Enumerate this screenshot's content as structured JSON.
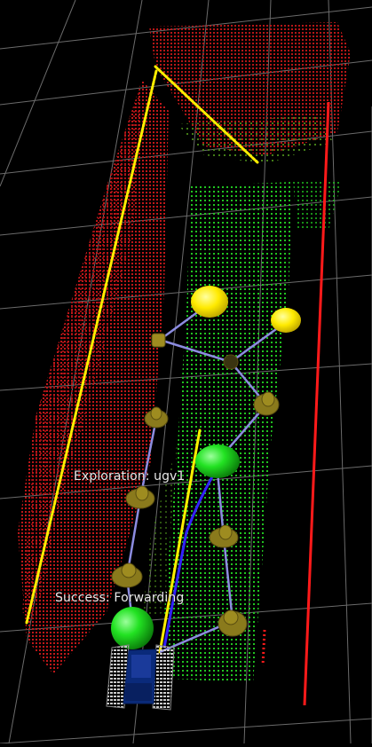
{
  "scene": {
    "background": "#000000",
    "grid_color": "#9a9a9a",
    "wall_color": "#c8181a",
    "floor_color": "#22cc22",
    "trajectory_color": "#ffee00",
    "laser_line_color": "#ff1a1a",
    "waypoint_color": "#8a7a1c",
    "frontier_goal_color": "#ffea00",
    "robot_marker_color": "#22ee22",
    "edge_color": "#8888dd",
    "path_color": "#3322ff"
  },
  "labels": {
    "exploration": "Exploration: ugv1",
    "success": "Success:  Forwarding"
  },
  "icons": {
    "robot": "ugv-robot-icon",
    "waypoint": "waypoint-marker-icon",
    "goal": "frontier-goal-icon",
    "current_position": "current-position-icon"
  }
}
